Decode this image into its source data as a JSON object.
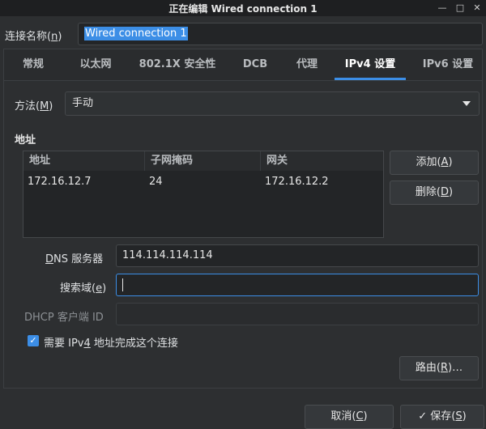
{
  "window": {
    "title": "正在编辑 Wired connection 1",
    "minimize": "—",
    "maximize": "□",
    "close": "✕"
  },
  "connection": {
    "name_label_pre": "连接名称(",
    "name_label_key": "n",
    "name_label_post": ")",
    "name_value": "Wired connection 1"
  },
  "tabs": [
    "常规",
    "以太网",
    "802.1X 安全性",
    "DCB",
    "代理",
    "IPv4 设置",
    "IPv6 设置"
  ],
  "active_tab": "IPv4 设置",
  "method": {
    "label_pre": "方法(",
    "label_key": "M",
    "label_post": ")",
    "value": "手动"
  },
  "addresses": {
    "section_title": "地址",
    "columns": [
      "地址",
      "子网掩码",
      "网关"
    ],
    "rows": [
      [
        "172.16.12.7",
        "24",
        "172.16.12.2"
      ]
    ],
    "add_button": "添加(",
    "add_key": "A",
    "add_button_post": ")",
    "delete_button": "删除(",
    "delete_key": "D",
    "delete_button_post": ")"
  },
  "dns": {
    "label_key": "D",
    "label_rest": "NS 服务器",
    "value": "114.114.114.114"
  },
  "search": {
    "label_pre": "搜索域(",
    "label_key": "e",
    "label_post": ")",
    "value": ""
  },
  "dhcp": {
    "label": "DHCP 客户端 ID",
    "value": ""
  },
  "require": {
    "label_pre": "需要 IPv",
    "label_key": "4",
    "label_post": " 地址完成这个连接",
    "checked": true
  },
  "routes_button_pre": "路由(",
  "routes_key": "R",
  "routes_button_post": ")…",
  "cancel_button_pre": "取消(",
  "cancel_key": "C",
  "cancel_button_post": ")",
  "save_button_pre": "保存(",
  "save_key": "S",
  "save_button_post": ")",
  "colors": {
    "accent": "#3c8ee6",
    "background": "#2d2f31",
    "field": "#232527"
  }
}
